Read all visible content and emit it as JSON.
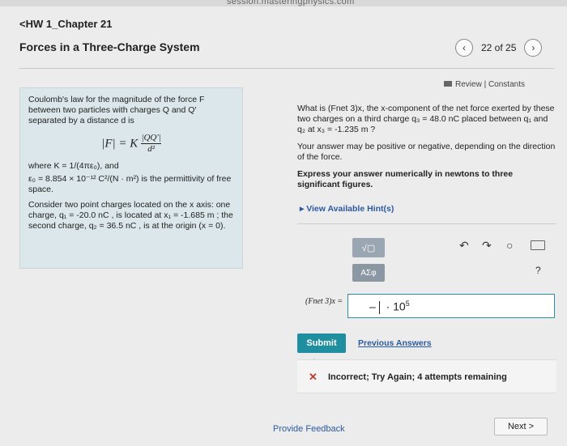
{
  "browser": {
    "url": "session.masteringphysics.com"
  },
  "header": {
    "back_label": "<HW 1_Chapter 21",
    "title": "Forces in a Three-Charge System",
    "pager": "22 of 25",
    "prev_icon": "chevron-left",
    "next_icon": "chevron-right"
  },
  "review": {
    "label": "Review | Constants"
  },
  "info": {
    "p1": "Coulomb's law for the magnitude of the force F between two particles with charges Q and Q′ separated by a distance d is",
    "formula_lhs": "|F| = K",
    "formula_num": "|QQ′|",
    "formula_den": "d²",
    "where": "where K = 1/(4πε₀), and",
    "eps": "ε₀ = 8.854 × 10⁻¹² C²/(N · m²) is the permittivity of free space.",
    "p2": "Consider two point charges located on the x axis: one charge, q₁ = -20.0 nC , is located at x₁ = -1.685 m ; the second charge, q₂ = 36.5 nC , is at the origin (x = 0)."
  },
  "question": {
    "q": "What is (Fnet 3)x, the x-component of the net force exerted by these two charges on a third charge q₃ = 48.0 nC placed between q₁ and q₂ at x₃ = -1.235 m ?",
    "note": "Your answer may be positive or negative, depending on the direction of the force.",
    "express": "Express your answer numerically in newtons to three significant figures.",
    "hint": "View Available Hint(s)"
  },
  "answer": {
    "tool_template": "√▢",
    "tool_symbols": "ΑΣφ",
    "undo": "↶",
    "redo": "↷",
    "reset": "○",
    "help": "?",
    "label": "(Fnet 3)x =",
    "value": "–",
    "sci": "· 10",
    "exp": "5"
  },
  "actions": {
    "submit": "Submit",
    "previous": "Previous Answers"
  },
  "feedback": {
    "text": "Incorrect; Try Again; 4 attempts remaining"
  },
  "footer": {
    "provide": "Provide Feedback",
    "next": "Next >"
  },
  "colors": {
    "accent": "#1f8fa0",
    "panel": "#dbe7ea",
    "error": "#c0392b",
    "link": "#2c5aa0"
  }
}
